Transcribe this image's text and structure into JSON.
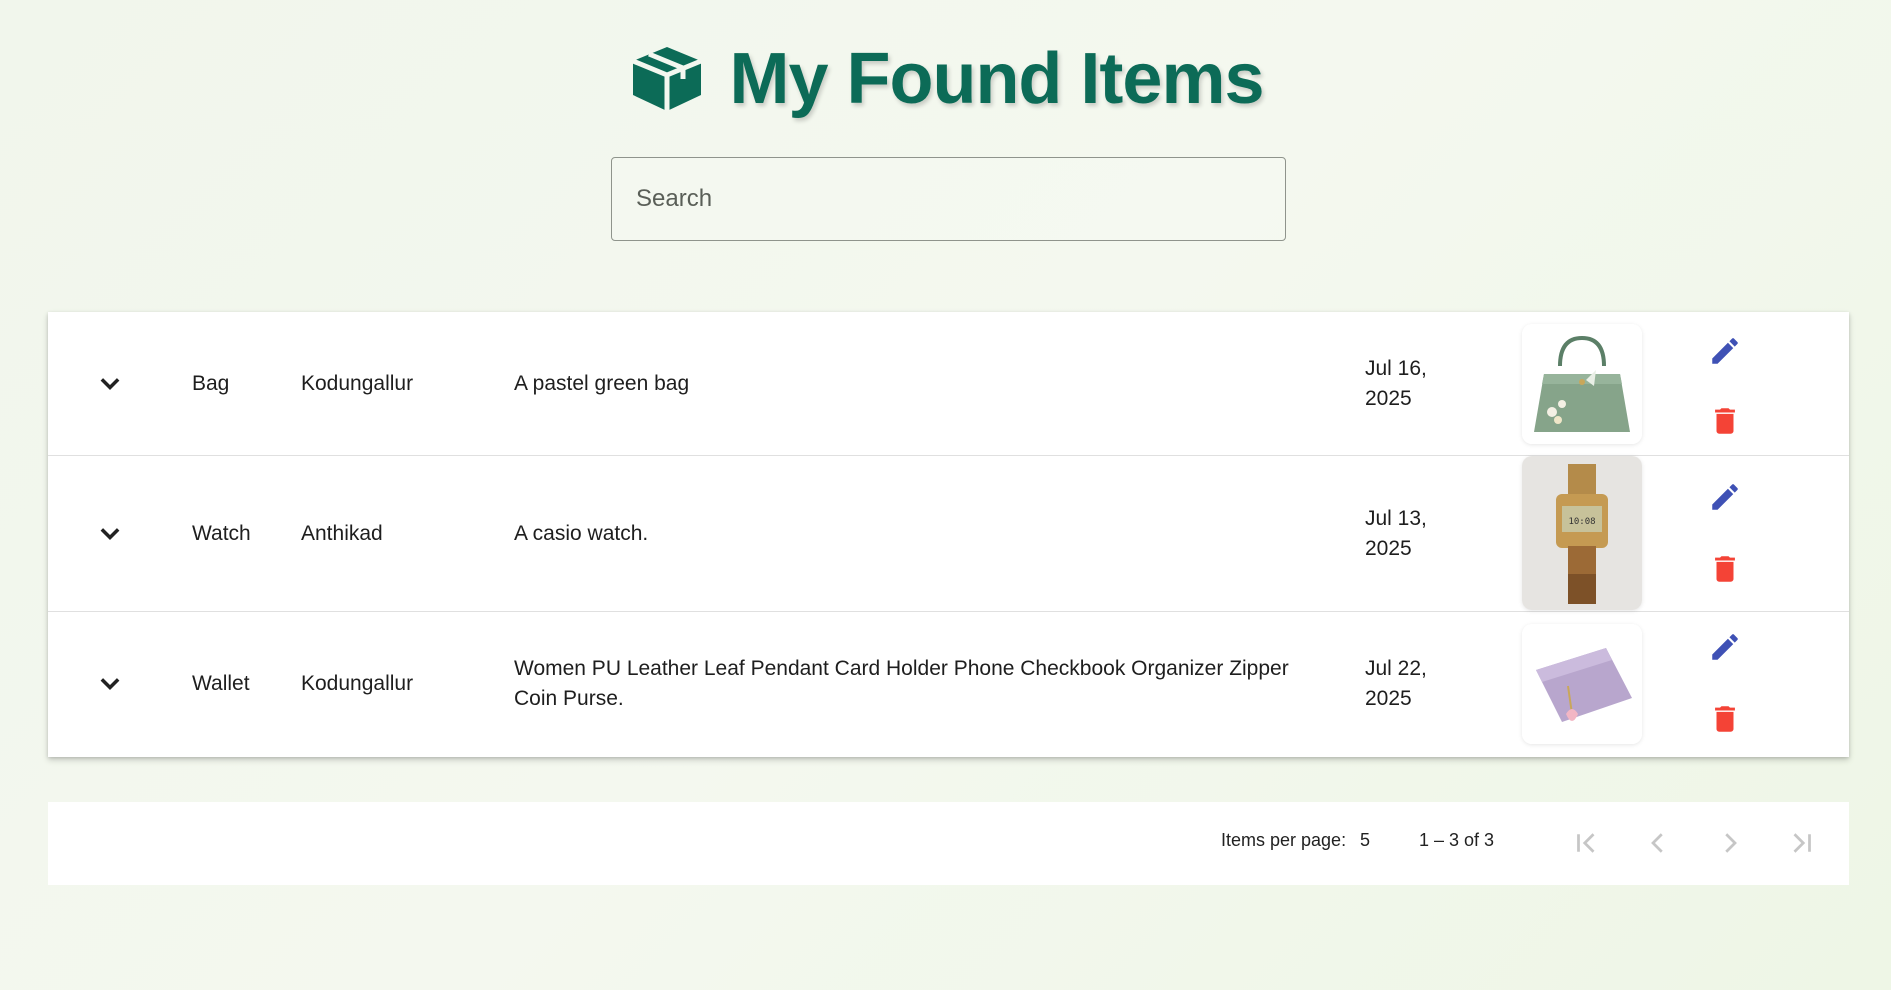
{
  "header": {
    "title": "My Found Items",
    "icon": "box-icon"
  },
  "search": {
    "placeholder": "Search",
    "value": ""
  },
  "items": [
    {
      "name": "Bag",
      "location": "Kodungallur",
      "description": "A pastel green bag",
      "date_line1": "Jul 16,",
      "date_line2": "2025",
      "image": "green-handbag"
    },
    {
      "name": "Watch",
      "location": "Anthikad",
      "description": "A casio watch.",
      "date_line1": "Jul 13,",
      "date_line2": "2025",
      "image": "gold-casio-watch"
    },
    {
      "name": "Wallet",
      "location": "Kodungallur",
      "description_line1": "Women PU Leather Leaf Pendant Card Holder Phone Checkbook Organizer Zipper",
      "description_line2": "Coin Purse.",
      "date_line1": "Jul 22,",
      "date_line2": "2025",
      "image": "lavender-wallet"
    }
  ],
  "paginator": {
    "items_per_page_label": "Items per page:",
    "items_per_page_value": "5",
    "range_label": "1 – 3 of 3"
  },
  "colors": {
    "title": "#0c6b57",
    "edit": "#3f51b5",
    "delete": "#f44336"
  }
}
